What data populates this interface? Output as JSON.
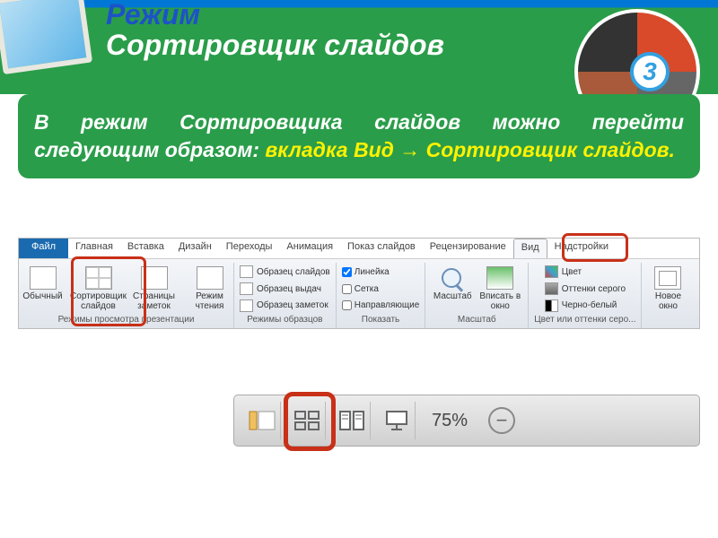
{
  "title": {
    "line1": "Режим",
    "line2": "Сортировщик слайдов"
  },
  "badge_number": "3",
  "info": {
    "part1": "В режим Сортировщика слайдов можно перейти следующим образом: ",
    "hl1": "вкладка Вид → Сортировщик слайдов."
  },
  "ribbon": {
    "tabs": {
      "file": "Файл",
      "home": "Главная",
      "insert": "Вставка",
      "design": "Дизайн",
      "transitions": "Переходы",
      "animation": "Анимация",
      "slideshow": "Показ слайдов",
      "review": "Рецензирование",
      "view": "Вид",
      "addins": "Надстройки"
    },
    "views": {
      "normal": "Обычный",
      "sorter": "Сортировщик слайдов",
      "notes": "Страницы заметок",
      "reading": "Режим чтения",
      "group_label": "Режимы просмотра презентации"
    },
    "masters": {
      "slide": "Образец слайдов",
      "handout": "Образец выдач",
      "notes": "Образец заметок",
      "group_label": "Режимы образцов"
    },
    "show": {
      "ruler": "Линейка",
      "gridlines": "Сетка",
      "guides": "Направляющие",
      "group_label": "Показать"
    },
    "zoom": {
      "zoom": "Масштаб",
      "fit": "Вписать в окно",
      "group_label": "Масштаб"
    },
    "color": {
      "color": "Цвет",
      "gray": "Оттенки серого",
      "bw": "Черно-белый",
      "group_label": "Цвет или оттенки серо..."
    },
    "window": {
      "new": "Новое окно"
    }
  },
  "statusbar": {
    "zoom_pct": "75%"
  }
}
